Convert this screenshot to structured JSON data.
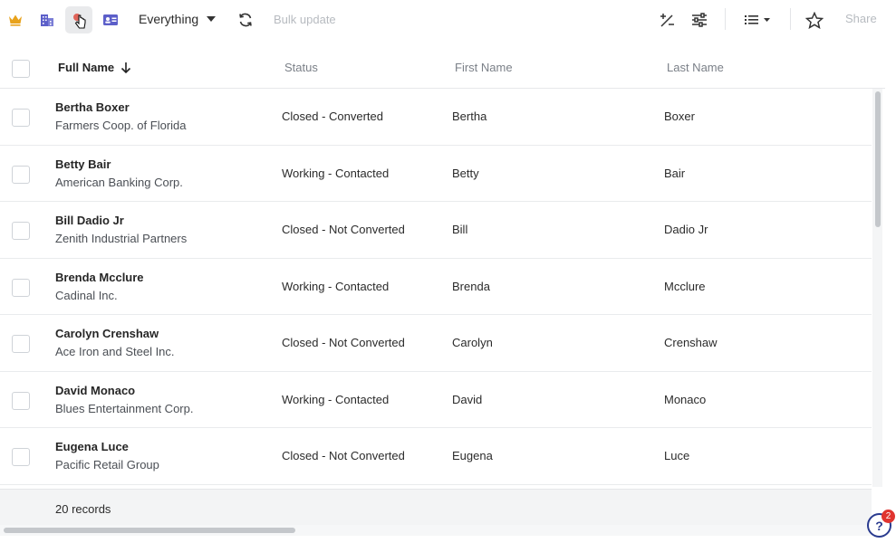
{
  "toolbar": {
    "view_label": "Everything",
    "bulk_label": "Bulk update",
    "share_label": "Share",
    "icons": [
      "crown-icon",
      "building-icon",
      "pointer-hand-icon",
      "id-card-icon",
      "refresh-icon",
      "plus-minus-icon",
      "sliders-icon",
      "list-view-icon",
      "star-icon"
    ],
    "accent_colors": {
      "crown": "#e8a21b",
      "building": "#5c5fc9",
      "card": "#5c5fc9"
    }
  },
  "table": {
    "columns": [
      "Full Name",
      "Status",
      "First Name",
      "Last Name"
    ],
    "rows": [
      {
        "full_name": "Bertha Boxer",
        "company": "Farmers Coop. of Florida",
        "status": "Closed - Converted",
        "first_name": "Bertha",
        "last_name": "Boxer"
      },
      {
        "full_name": "Betty Bair",
        "company": "American Banking Corp.",
        "status": "Working - Contacted",
        "first_name": "Betty",
        "last_name": "Bair"
      },
      {
        "full_name": "Bill Dadio Jr",
        "company": "Zenith Industrial Partners",
        "status": "Closed - Not Converted",
        "first_name": "Bill",
        "last_name": "Dadio Jr"
      },
      {
        "full_name": "Brenda Mcclure",
        "company": "Cadinal Inc.",
        "status": "Working - Contacted",
        "first_name": "Brenda",
        "last_name": "Mcclure"
      },
      {
        "full_name": "Carolyn Crenshaw",
        "company": "Ace Iron and Steel Inc.",
        "status": "Closed - Not Converted",
        "first_name": "Carolyn",
        "last_name": "Crenshaw"
      },
      {
        "full_name": "David Monaco",
        "company": "Blues Entertainment Corp.",
        "status": "Working - Contacted",
        "first_name": "David",
        "last_name": "Monaco"
      },
      {
        "full_name": "Eugena Luce",
        "company": "Pacific Retail Group",
        "status": "Closed - Not Converted",
        "first_name": "Eugena",
        "last_name": "Luce"
      }
    ]
  },
  "footer": {
    "record_count": "20 records"
  },
  "help": {
    "label": "?",
    "badge": "2"
  }
}
